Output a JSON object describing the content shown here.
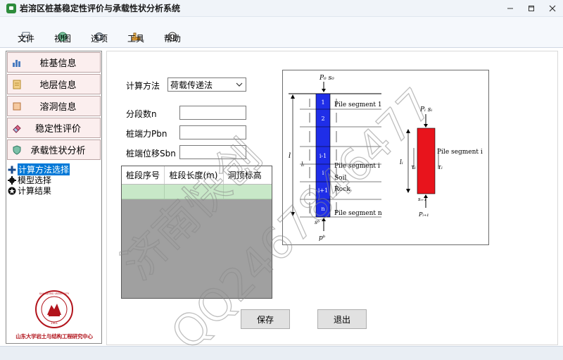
{
  "window": {
    "title": "岩溶区桩基稳定性评价与承载性状分析系统",
    "controls": [
      "minimize",
      "maximize",
      "close"
    ]
  },
  "toolbar": [
    {
      "label": "文件",
      "icon": "file-icon"
    },
    {
      "label": "视图",
      "icon": "view-icon"
    },
    {
      "label": "选项",
      "icon": "options-icon"
    },
    {
      "label": "工具",
      "icon": "tools-icon"
    },
    {
      "label": "帮助",
      "icon": "help-icon"
    }
  ],
  "sidebar": {
    "nav": [
      {
        "label": "桩基信息",
        "icon": "bar-chart-icon"
      },
      {
        "label": "地层信息",
        "icon": "document-icon"
      },
      {
        "label": "溶洞信息",
        "icon": "box-icon"
      },
      {
        "label": "稳定性评价",
        "icon": "eraser-icon"
      },
      {
        "label": "承载性状分析",
        "icon": "shield-icon"
      }
    ],
    "tree": [
      {
        "label": "计算方法选择",
        "icon": "plus-icon",
        "selected": true
      },
      {
        "label": "模型选择",
        "icon": "gear-icon",
        "selected": false
      },
      {
        "label": "计算结果",
        "icon": "star-icon",
        "selected": false
      }
    ],
    "logo": {
      "seal_text": "SHANDONG UNIVERSITY",
      "year": "1901",
      "caption": "山东大学岩土与结构工程研究中心"
    }
  },
  "form": {
    "method_label": "计算方法",
    "method_value": "荷载传递法",
    "segments_label": "分段数n",
    "segments_value": "",
    "tip_force_label": "桩端力Pbn",
    "tip_force_value": "",
    "tip_disp_label": "桩端位移Sbn",
    "tip_disp_value": ""
  },
  "table": {
    "headers": [
      "桩段序号",
      "桩段长度(m)",
      "洞顶标高"
    ],
    "rows": [
      [
        "",
        "",
        ""
      ]
    ]
  },
  "diagram": {
    "top_load": "P₀ s₀",
    "bottom_load": "pᵇ",
    "bottom_disp": "sᵇ",
    "seg_labels": [
      "1",
      "2",
      "i-1",
      "i",
      "i+1",
      "n"
    ],
    "label_pile_seg_1": "Pile segment 1",
    "label_pile_seg_i": "Pile segment i",
    "label_soil": "Soil",
    "label_rock": "Rock",
    "label_pile_seg_n": "Pile segment n",
    "l": "l",
    "li": "lᵢ",
    "right_top": "Pᵢ sᵢ",
    "right_bottom_s": "sᵢ₊₁",
    "right_bottom_p": "Pᵢ₊₁",
    "tau": "τᵢ",
    "right_pile_label": "Pile segment i",
    "right_li": "lᵢ"
  },
  "buttons": {
    "save": "保存",
    "exit": "退出"
  },
  "watermark": {
    "line1": "济南快创",
    "line2": "QQ2467846477"
  },
  "colors": {
    "nav_bg": "#fbeeee",
    "selected": "#0078d7",
    "grid_row": "#c8e8c8",
    "pile_blue": "#1f2ee8",
    "pile_red": "#e8141c",
    "logo_red": "#b2141c"
  }
}
